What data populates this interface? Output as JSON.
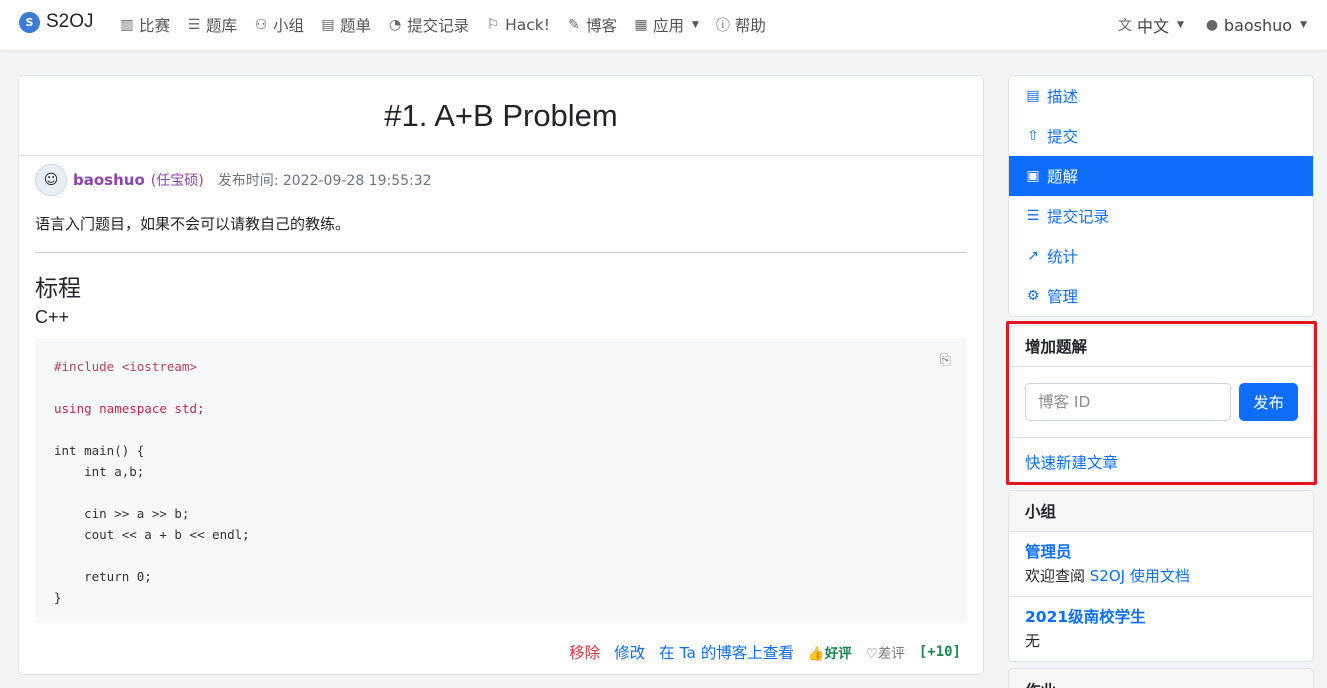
{
  "navbar": {
    "brand": "S2OJ",
    "items": [
      {
        "label": "比赛",
        "icon": "bar-chart-icon"
      },
      {
        "label": "题库",
        "icon": "list-icon"
      },
      {
        "label": "小组",
        "icon": "people-icon"
      },
      {
        "label": "题单",
        "icon": "card-list-icon"
      },
      {
        "label": "提交记录",
        "icon": "pie-chart-icon"
      },
      {
        "label": "Hack!",
        "icon": "flag-icon"
      },
      {
        "label": "博客",
        "icon": "pencil-square-icon"
      },
      {
        "label": "应用",
        "icon": "grid-icon"
      },
      {
        "label": "帮助",
        "icon": "question-circle-icon"
      }
    ],
    "language": "中文",
    "user": "baoshuo"
  },
  "problem": {
    "title": "#1. A+B Problem"
  },
  "post": {
    "author": "baoshuo",
    "realname": "(任宝硕)",
    "pub_time": "发布时间: 2022-09-28 19:55:32",
    "intro": "语言入门题目，如果不会可以请教自己的教练。",
    "heading": "标程",
    "lang": "C++",
    "code_lines": [
      "#include <iostream>",
      "",
      "using namespace std;",
      "",
      "int main() {",
      "    int a,b;",
      "",
      "    cin >> a >> b;",
      "    cout << a + b << endl;",
      "",
      "    return 0;",
      "}"
    ],
    "actions": {
      "remove": "移除",
      "edit": "修改",
      "view": "在 Ta 的博客上查看"
    },
    "votes": {
      "good": "好评",
      "bad": "差评",
      "score": "[+10]"
    }
  },
  "sidebar": {
    "menu": [
      {
        "label": "描述",
        "icon": "file-text-icon",
        "active": false
      },
      {
        "label": "提交",
        "icon": "upload-icon",
        "active": false
      },
      {
        "label": "题解",
        "icon": "journal-icon",
        "active": true
      },
      {
        "label": "提交记录",
        "icon": "list-icon",
        "active": false
      },
      {
        "label": "统计",
        "icon": "graph-icon",
        "active": false
      },
      {
        "label": "管理",
        "icon": "sliders-icon",
        "active": false
      }
    ],
    "add_solution": {
      "title": "增加题解",
      "placeholder": "博客 ID",
      "button": "发布",
      "quick_link": "快速新建文章"
    },
    "groups": {
      "title": "小组",
      "items": [
        {
          "name": "管理员",
          "desc_prefix": "欢迎查阅 ",
          "desc_link": "S2OJ 使用文档"
        },
        {
          "name": "2021级南校学生",
          "desc_prefix": "无",
          "desc_link": ""
        }
      ]
    },
    "homework": {
      "title": "作业"
    }
  },
  "colors": {
    "primary": "#0d6efd",
    "author": "#8e44ad",
    "danger": "#dc3545",
    "success": "#198754",
    "highlight": "#e3161f"
  }
}
